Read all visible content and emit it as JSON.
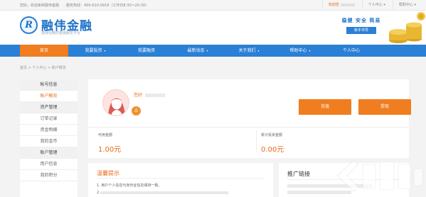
{
  "topbar": {
    "welcome": "您好，欢迎来到融伟金融",
    "hotline": "服务热线：400-610-0918（工作日8:30～20:30）",
    "user_prefix": "欢迎您",
    "personal_center": "个人中心",
    "help_center": "帮助中心",
    "chevron": "▾"
  },
  "header": {
    "logo_letter": "R",
    "logo_name": "融伟金融",
    "logo_sub": "值得信赖的金融服务平台",
    "slogan": "稳健 安全 简易",
    "slogan_button": "新手市导"
  },
  "nav": {
    "items": [
      {
        "label": "首页",
        "active": true,
        "dropdown": false
      },
      {
        "label": "我要投资",
        "active": false,
        "dropdown": true
      },
      {
        "label": "我要融资",
        "active": false,
        "dropdown": false
      },
      {
        "label": "最新动态",
        "active": false,
        "dropdown": true
      },
      {
        "label": "关于我们",
        "active": false,
        "dropdown": true
      },
      {
        "label": "帮助中心",
        "active": false,
        "dropdown": true
      },
      {
        "label": "个人中心",
        "active": false,
        "dropdown": false
      }
    ]
  },
  "breadcrumb": "首页 > 个人中心 > 账户概览",
  "sidebar": {
    "items": [
      {
        "label": "帐号信息",
        "kind": "sec"
      },
      {
        "label": "账户概览",
        "kind": "act"
      },
      {
        "label": "资产管理",
        "kind": "sec"
      },
      {
        "label": "订单记录",
        "kind": ""
      },
      {
        "label": "资金明细",
        "kind": ""
      },
      {
        "label": "我的金币",
        "kind": ""
      },
      {
        "label": "账户管理",
        "kind": "sec"
      },
      {
        "label": "用户信息",
        "kind": ""
      },
      {
        "label": "我的积分",
        "kind": ""
      }
    ]
  },
  "account": {
    "greeting": "您好",
    "recharge": "充值",
    "withdraw": "提现",
    "balance_label": "可用金额",
    "balance_value": "1.00元",
    "invest_label": "累计投资金额",
    "invest_value": "0.00元"
  },
  "tips": {
    "title": "温馨提示",
    "line1": "1. 用户个人信息与身份证信息保持一致。",
    "line2": "2. "
  },
  "promo": {
    "title": "推广链接"
  },
  "colors": {
    "brand_blue": "#2a7fd6",
    "accent_orange": "#f07d1f"
  }
}
